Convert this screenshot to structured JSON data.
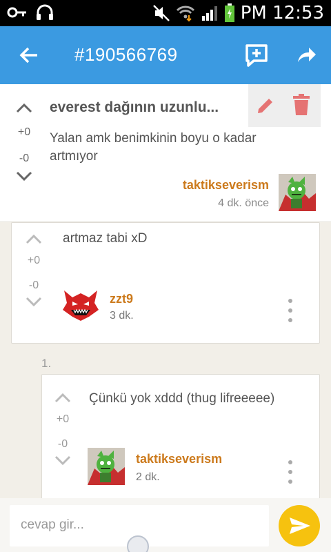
{
  "status_bar": {
    "time": "PM 12:53"
  },
  "app_bar": {
    "title": "#190566769"
  },
  "post": {
    "title": "everest dağının uzunlu...",
    "upvotes": "+0",
    "downvotes": "-0",
    "body": "Yalan amk benimkinin boyu o kadar artmıyor",
    "author": "taktikseverism",
    "time": "4 dk. önce"
  },
  "comments": [
    {
      "text": "artmaz tabi xD",
      "upvotes": "+0",
      "downvotes": "-0",
      "author": "zzt9",
      "time": "3 dk."
    },
    {
      "index": "1.",
      "text": "Çünkü yok xddd (thug lifreeeee)",
      "upvotes": "+0",
      "downvotes": "-0",
      "author": "taktikseverism",
      "time": "2 dk."
    }
  ],
  "reply_input": {
    "placeholder": "cevap gir..."
  },
  "colors": {
    "app_bar": "#3b9ae1",
    "author": "#cc7a1c",
    "delete": "#e57373",
    "edit": "#e57373",
    "send": "#f6c20f"
  }
}
